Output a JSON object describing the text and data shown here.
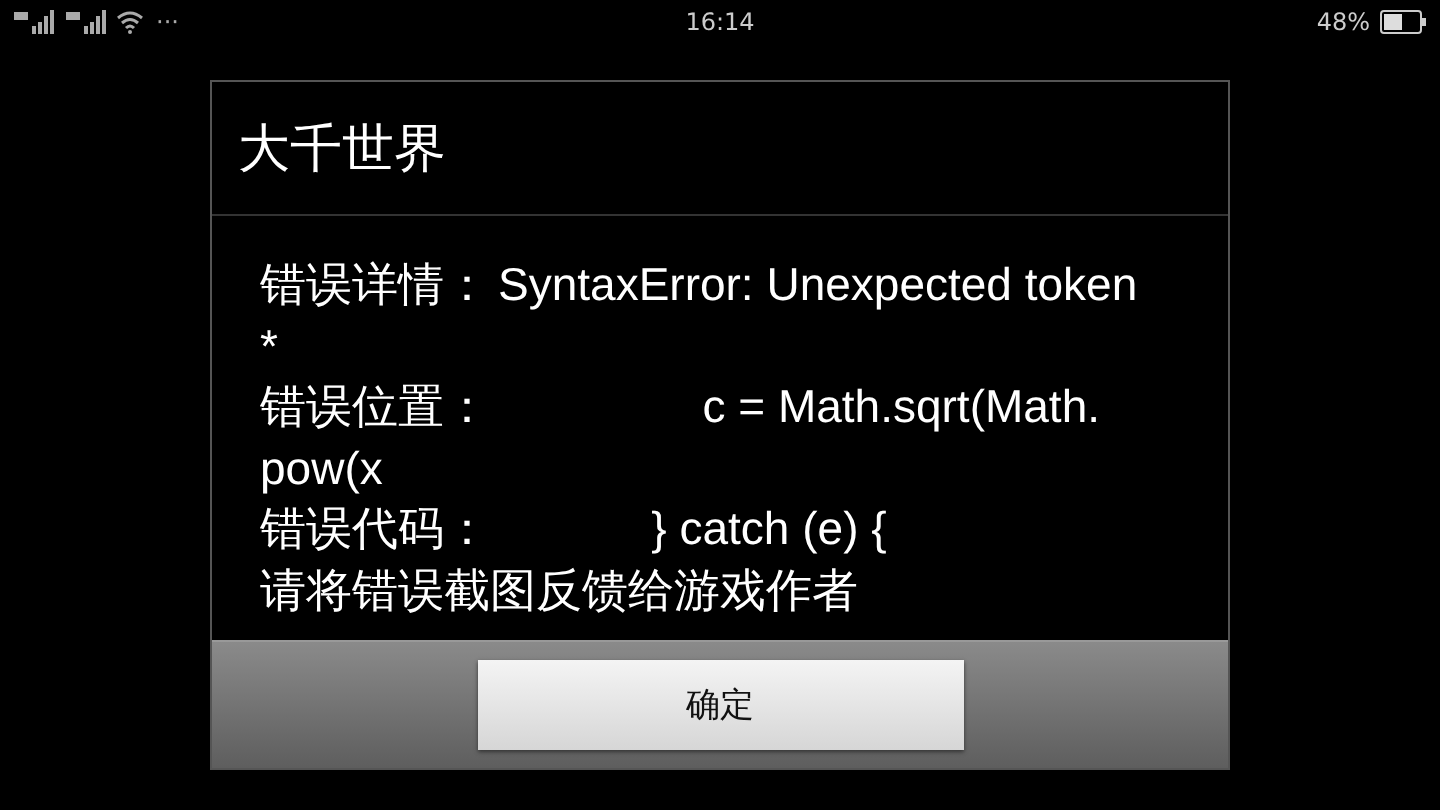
{
  "status_bar": {
    "time": "16:14",
    "battery_text": "48%",
    "more": "···"
  },
  "dialog": {
    "title": "大千世界",
    "lines": [
      {
        "kind": "field",
        "label": "错误详情：",
        "value": "SyntaxError: Unexpected token"
      },
      {
        "kind": "wrap",
        "value": "*"
      },
      {
        "kind": "field",
        "label": "错误位置：",
        "value": "                c = Math.sqrt(Math."
      },
      {
        "kind": "wrap",
        "value": "pow(x"
      },
      {
        "kind": "field",
        "label": "错误代码：",
        "value": "            } catch (e) {"
      },
      {
        "kind": "plain",
        "value": "请将错误截图反馈给游戏作者"
      }
    ],
    "button": "确定"
  }
}
